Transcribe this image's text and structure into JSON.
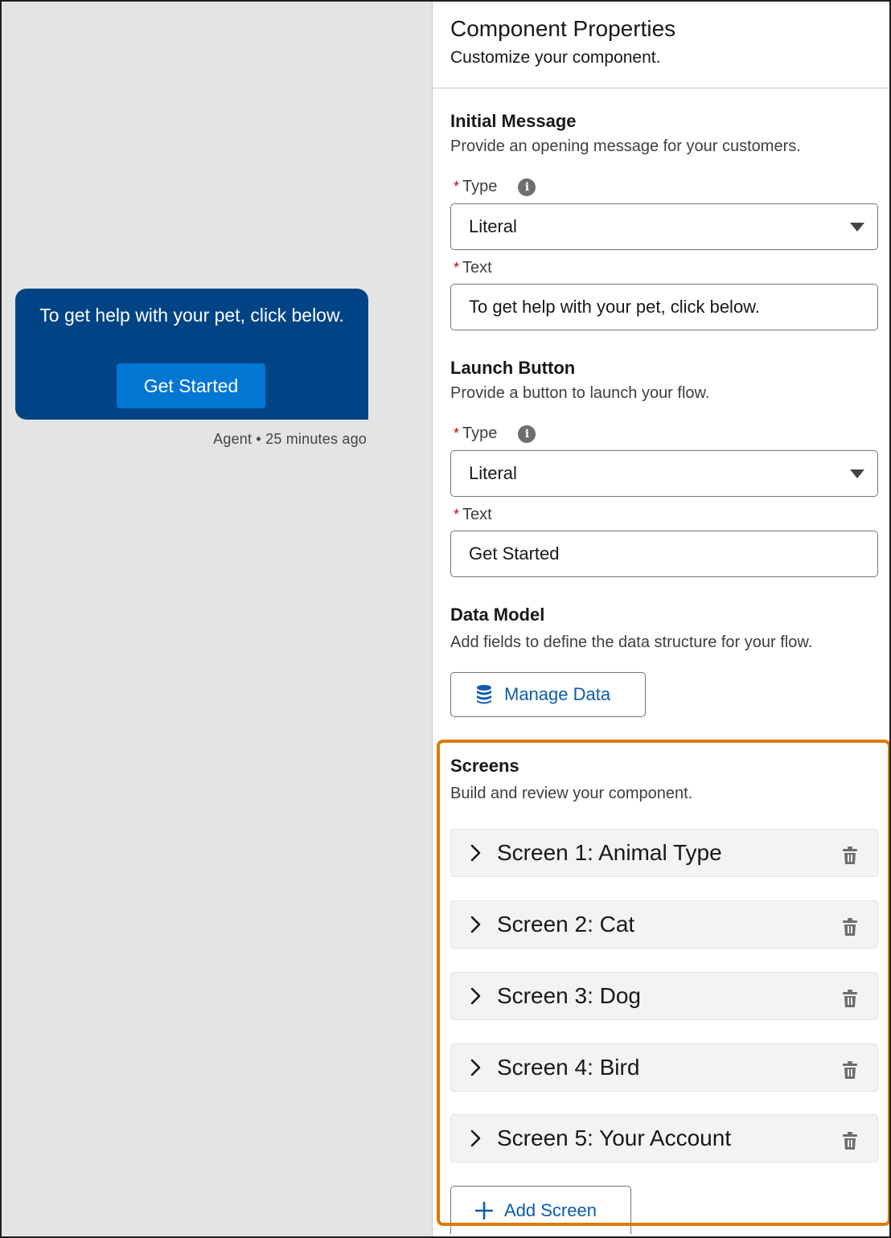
{
  "preview": {
    "bubble_text": "To get help with your pet, click below.",
    "bubble_button": "Get Started",
    "meta": "Agent • 25 minutes ago"
  },
  "panel": {
    "title": "Component Properties",
    "subtitle": "Customize your component."
  },
  "initial_message": {
    "title": "Initial Message",
    "description": "Provide an opening message for your customers.",
    "type_label": "Type",
    "type_value": "Literal",
    "text_label": "Text",
    "text_value": "To get help with your pet, click below."
  },
  "launch_button": {
    "title": "Launch Button",
    "description": "Provide a button to launch your flow.",
    "type_label": "Type",
    "type_value": "Literal",
    "text_label": "Text",
    "text_value": "Get Started"
  },
  "data_model": {
    "title": "Data Model",
    "description": "Add fields to define the data structure for your flow.",
    "button_label": "Manage Data"
  },
  "screens": {
    "title": "Screens",
    "description": "Build and review your component.",
    "items": [
      {
        "label": "Screen 1: Animal Type"
      },
      {
        "label": "Screen 2: Cat"
      },
      {
        "label": "Screen 3: Dog"
      },
      {
        "label": "Screen 4: Bird"
      },
      {
        "label": "Screen 5: Your Account"
      }
    ],
    "add_label": "Add Screen"
  },
  "colors": {
    "bubble": "#014486",
    "brand": "#0176d3",
    "link": "#0b5cab",
    "highlight": "#dd7a01",
    "required": "#ba0517"
  },
  "icons": [
    "info-icon",
    "dropdown-caret-icon",
    "database-icon",
    "chevron-right-icon",
    "trash-icon",
    "plus-icon"
  ]
}
